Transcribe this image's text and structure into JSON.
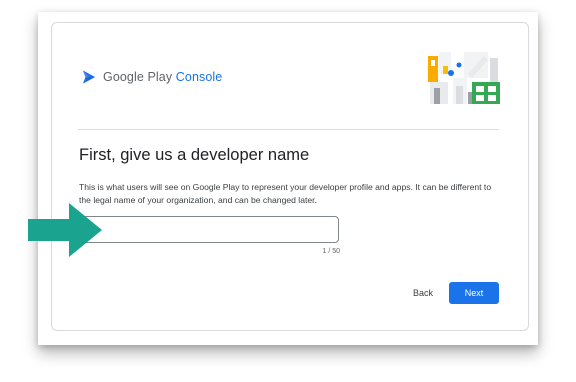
{
  "brand": {
    "name_prefix": "Google Play ",
    "name_suffix": "Console",
    "icon": "google-play-console-logo"
  },
  "header": {
    "illustration": "building-blocks-illustration"
  },
  "main": {
    "title": "First, give us a developer name",
    "description": "This is what users will see on Google Play to represent your developer profile and apps. It can be different to the legal name of your organization, and can be changed later.",
    "developer_name": {
      "value": "",
      "placeholder": "",
      "counter": "1 / 50"
    }
  },
  "annotation": {
    "icon": "arrow-right-icon",
    "color": "#1aa38f"
  },
  "actions": {
    "back_label": "Back",
    "next_label": "Next"
  },
  "colors": {
    "accent": "#1a73e8",
    "arrow": "#1aa38f"
  }
}
